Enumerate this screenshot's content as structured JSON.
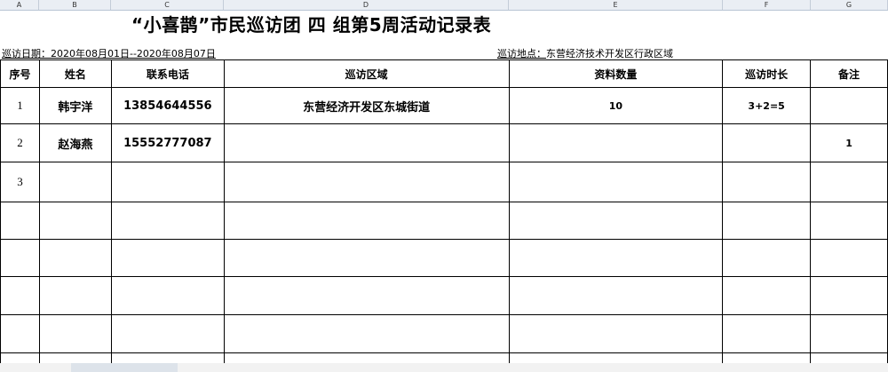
{
  "columns": [
    "A",
    "B",
    "C",
    "D",
    "E",
    "F",
    "G"
  ],
  "title": "“小喜鹊”市民巡访团 四 组第5周活动记录表",
  "info": {
    "date_label": "巡访日期：",
    "date_value": "2020年08月01日--2020年08月07日",
    "place_label": "巡访地点：",
    "place_value": "东营经济技术开发区行政区域"
  },
  "table": {
    "headers": [
      "序号",
      "姓名",
      "联系电话",
      "巡访区域",
      "资料数量",
      "巡访时长",
      "备注"
    ],
    "rows": [
      [
        "1",
        "韩宇洋",
        "13854644556",
        "东营经济开发区东城街道",
        "10",
        "3+2=5",
        ""
      ],
      [
        "2",
        "赵海燕",
        "15552777087",
        "",
        "",
        "",
        "1"
      ],
      [
        "3",
        "",
        "",
        "",
        "",
        "",
        ""
      ],
      [
        "",
        "",
        "",
        "",
        "",
        "",
        ""
      ],
      [
        "",
        "",
        "",
        "",
        "",
        "",
        ""
      ],
      [
        "",
        "",
        "",
        "",
        "",
        "",
        ""
      ],
      [
        "",
        "",
        "",
        "",
        "",
        "",
        ""
      ],
      [
        "",
        "",
        "",
        "",
        "",
        "",
        ""
      ]
    ]
  }
}
